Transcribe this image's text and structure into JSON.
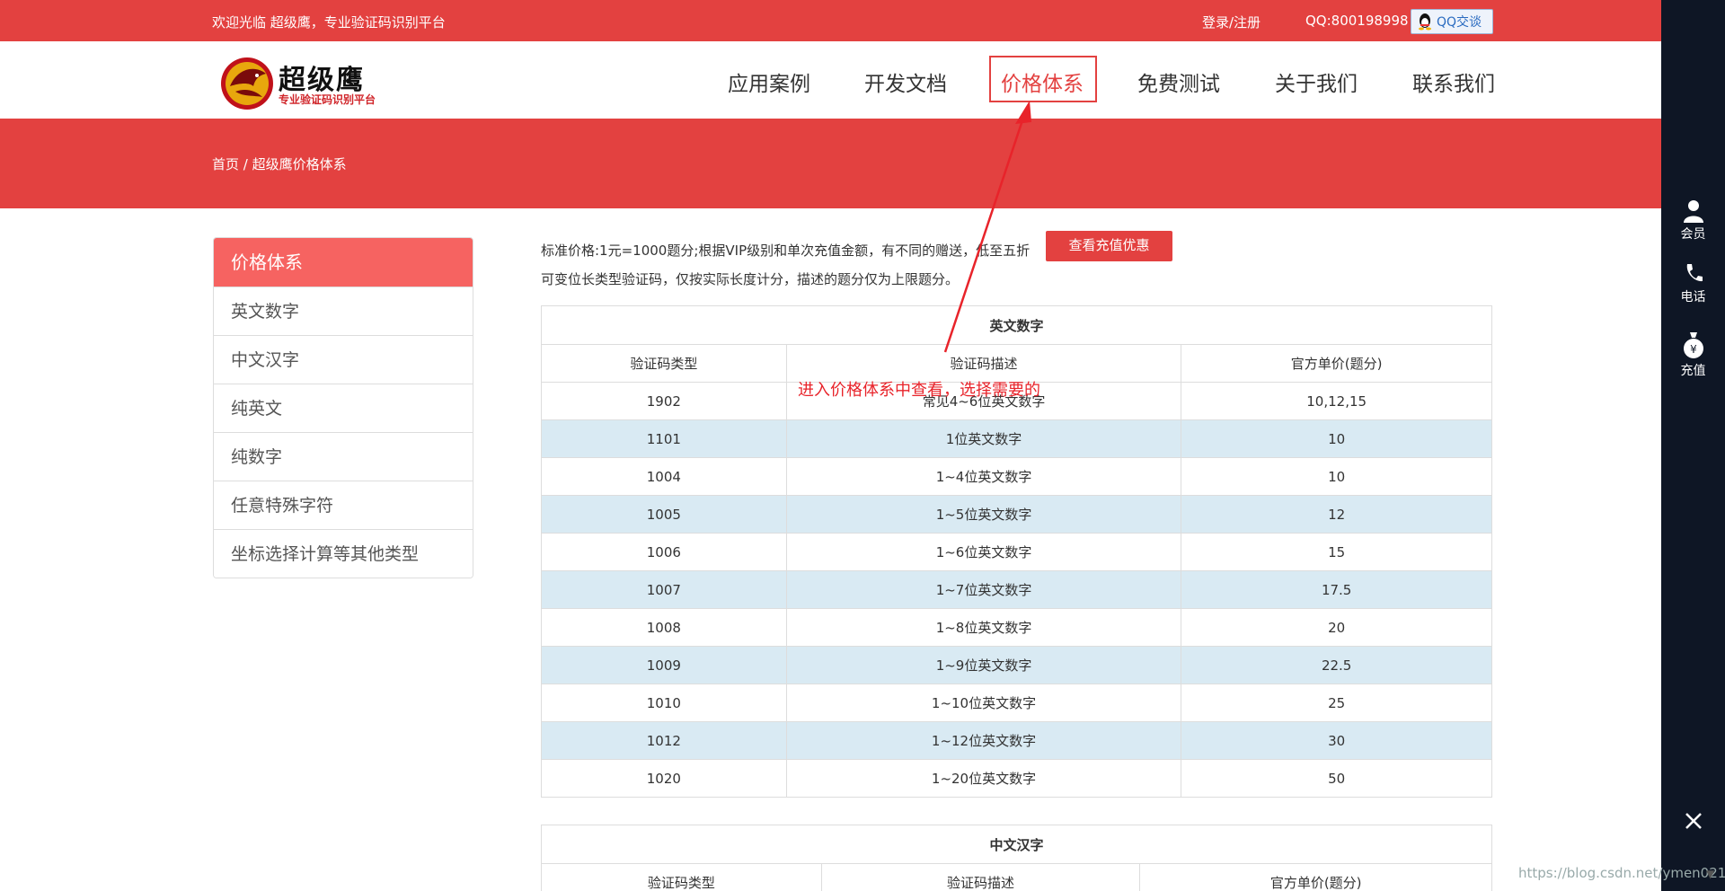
{
  "topbar": {
    "welcome": "欢迎光临 超级鹰，专业验证码识别平台",
    "login": "登录/注册",
    "qq": "QQ:800198998",
    "qq_button": "QQ交谈"
  },
  "logo": {
    "title": "超级鹰",
    "subtitle": "专业验证码识别平台"
  },
  "nav": [
    "应用案例",
    "开发文档",
    "价格体系",
    "免费测试",
    "关于我们",
    "联系我们"
  ],
  "breadcrumb": "首页 / 超级鹰价格体系",
  "sidebar": {
    "title": "价格体系",
    "items": [
      "英文数字",
      "中文汉字",
      "纯英文",
      "纯数字",
      "任意特殊字符",
      "坐标选择计算等其他类型"
    ]
  },
  "intro": {
    "line1": "标准价格:1元=1000题分;根据VIP级别和单次充值金额，有不同的赠送，低至五折",
    "line2": "可变位长类型验证码，仅按实际长度计分，描述的题分仅为上限题分。",
    "button": "查看充值优惠"
  },
  "table_en": {
    "caption": "英文数字",
    "headers": [
      "验证码类型",
      "验证码描述",
      "官方单价(题分)"
    ],
    "rows": [
      [
        "1902",
        "常见4~6位英文数字",
        "10,12,15"
      ],
      [
        "1101",
        "1位英文数字",
        "10"
      ],
      [
        "1004",
        "1~4位英文数字",
        "10"
      ],
      [
        "1005",
        "1~5位英文数字",
        "12"
      ],
      [
        "1006",
        "1~6位英文数字",
        "15"
      ],
      [
        "1007",
        "1~7位英文数字",
        "17.5"
      ],
      [
        "1008",
        "1~8位英文数字",
        "20"
      ],
      [
        "1009",
        "1~9位英文数字",
        "22.5"
      ],
      [
        "1010",
        "1~10位英文数字",
        "25"
      ],
      [
        "1012",
        "1~12位英文数字",
        "30"
      ],
      [
        "1020",
        "1~20位英文数字",
        "50"
      ]
    ]
  },
  "table_cn": {
    "caption": "中文汉字",
    "headers": [
      "验证码类型",
      "验证码描述",
      "官方单价(题分)"
    ]
  },
  "rightbar": {
    "member": "会员",
    "phone": "电话",
    "recharge": "充值"
  },
  "annotation": "进入价格体系中查看，选择需要的",
  "watermark": "https://blog.csdn.net/ymen021",
  "colors": {
    "brand_red": "#e34140",
    "row_highlight": "#d9eaf3",
    "rightbar_bg": "#0e1625"
  }
}
